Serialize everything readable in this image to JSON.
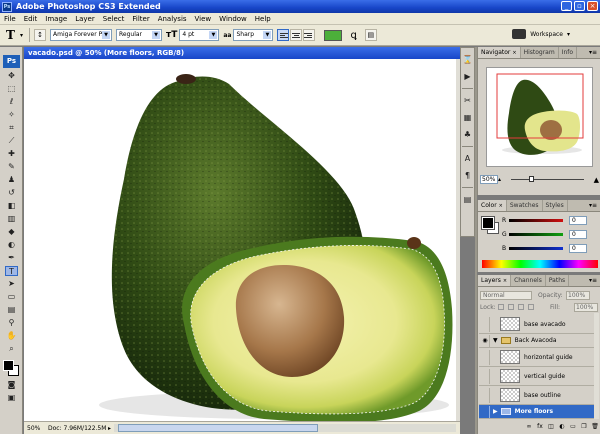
{
  "window": {
    "title": "Adobe Photoshop CS3 Extended",
    "app_icon": "Ps"
  },
  "menu": [
    "File",
    "Edit",
    "Image",
    "Layer",
    "Select",
    "Filter",
    "Analysis",
    "View",
    "Window",
    "Help"
  ],
  "options": {
    "tool_glyph": "T",
    "font_family": "Amiga Forever P...",
    "font_style": "Regular",
    "font_size": "4 pt",
    "antialias_icon": "aa",
    "antialias": "Sharp",
    "text_color": "#4caf3a",
    "workspace": "Workspace"
  },
  "tools": {
    "logo": "Ps"
  },
  "document": {
    "title": "vacado.psd @ 50% (More floors, RGB/8)",
    "zoom": "50%",
    "doc_info": "Doc: 7.96M/122.5M"
  },
  "navigator": {
    "tabs": [
      "Navigator",
      "Histogram",
      "Info"
    ],
    "zoom": "50%",
    "view_box_color": "#e33b3b",
    "zoom_slider_fraction": 0.27
  },
  "color_panel": {
    "tabs": [
      "Color",
      "Swatches",
      "Styles"
    ],
    "channels": [
      {
        "label": "R",
        "value": "0",
        "color": "#d01010"
      },
      {
        "label": "G",
        "value": "0",
        "color": "#10a010"
      },
      {
        "label": "B",
        "value": "0",
        "color": "#1030d0"
      }
    ]
  },
  "layers_panel": {
    "tabs": [
      "Layers",
      "Channels",
      "Paths"
    ],
    "blend_mode": "Normal",
    "opacity_label": "Opacity:",
    "opacity": "100%",
    "lock_label": "Lock:",
    "fill_label": "Fill:",
    "fill": "100%",
    "layers": [
      {
        "name": "base avacado",
        "kind": "layer"
      },
      {
        "name": "Back Avacoda",
        "kind": "group",
        "visible": true
      },
      {
        "name": "horizontal guide",
        "kind": "layer"
      },
      {
        "name": "vertical guide",
        "kind": "layer"
      },
      {
        "name": "base outline",
        "kind": "layer"
      },
      {
        "name": "More floors",
        "kind": "group",
        "selected": true
      }
    ]
  }
}
